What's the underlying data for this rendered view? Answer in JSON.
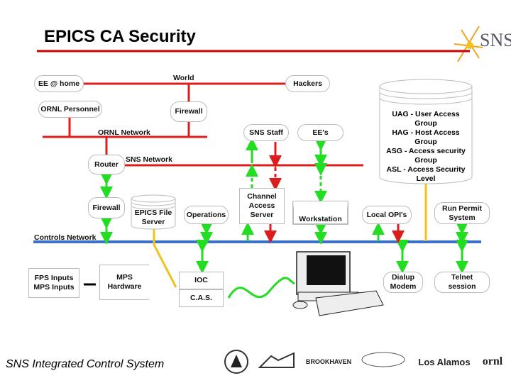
{
  "title": "EPICS CA Security",
  "logo_text": "SNS",
  "footer": "SNS Integrated Control System",
  "networks": {
    "world": "World",
    "ornl": "ORNL Network",
    "sns": "SNS Network",
    "controls": "Controls Network"
  },
  "nodes": {
    "ee_home": "EE @ home",
    "hackers": "Hackers",
    "ornl_personnel": "ORNL Personnel",
    "firewall_top": "Firewall",
    "router": "Router",
    "firewall_mid": "Firewall",
    "sns_staff": "SNS Staff",
    "ees": "EE's",
    "file_server": "EPICS File Server",
    "operations": "Operations",
    "ca_server": "Channel Access Server",
    "workstation": "Workstation",
    "local_opis": "Local OPI's",
    "run_permit": "Run Permit System",
    "fps_mps": "FPS Inputs MPS Inputs",
    "mps_hardware": "MPS Hardware",
    "ioc": "IOC",
    "cas": "C.A.S.",
    "dialup": "Dialup Modem",
    "telnet": "Telnet session"
  },
  "security_db": [
    "UAG - User Access Group",
    "HAG - Host Access Group",
    "ASG - Access security Group",
    "ASL - Access Security Level"
  ],
  "logos": [
    "BROOKHAVEN",
    "Los Alamos",
    "ornl"
  ],
  "colors": {
    "internet": "#dd1c1c",
    "controls": "#3a6fd8",
    "allowed": "#22dd22",
    "denied": "#dd1c1c",
    "config": "#f2c21c"
  }
}
